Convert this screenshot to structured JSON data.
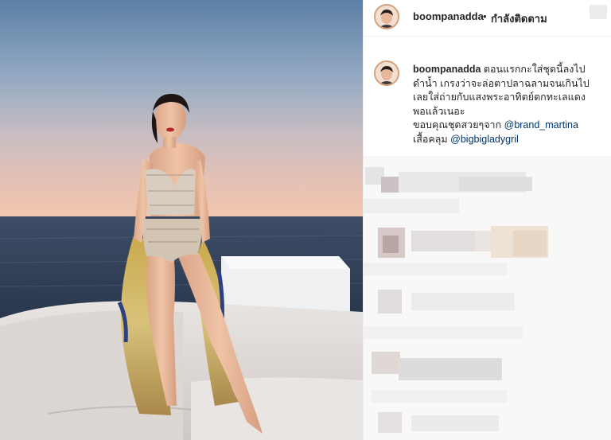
{
  "header": {
    "username": "boompanadda",
    "separator": "•",
    "follow_label": "กำลังติดตาม"
  },
  "caption": {
    "username": "boompanadda",
    "line1": "ตอนแรกกะใส่ชุดนี้ลงไป",
    "line2": "ดำน้ำ เกรงว่าจะล่อตาปลาฉลามจนเกินไป",
    "line3": "เลยใส่ถ่ายกับแสงพระอาทิตย์ตกทะเลแดง",
    "line4": "พอแล้วเนอะ",
    "line5_text": "ขอบคุณชุดสวยๆจาก ",
    "line5_mention": "@brand_martina",
    "line6_text": "เสื้อคลุม ",
    "line6_mention": "@bigbigladygril"
  },
  "icons": {
    "more": "more-options-icon",
    "avatar": "profile-avatar"
  },
  "colors": {
    "text": "#262626",
    "mention": "#003569",
    "divider": "#efefef",
    "avatar_ring": "#d6a07a"
  }
}
